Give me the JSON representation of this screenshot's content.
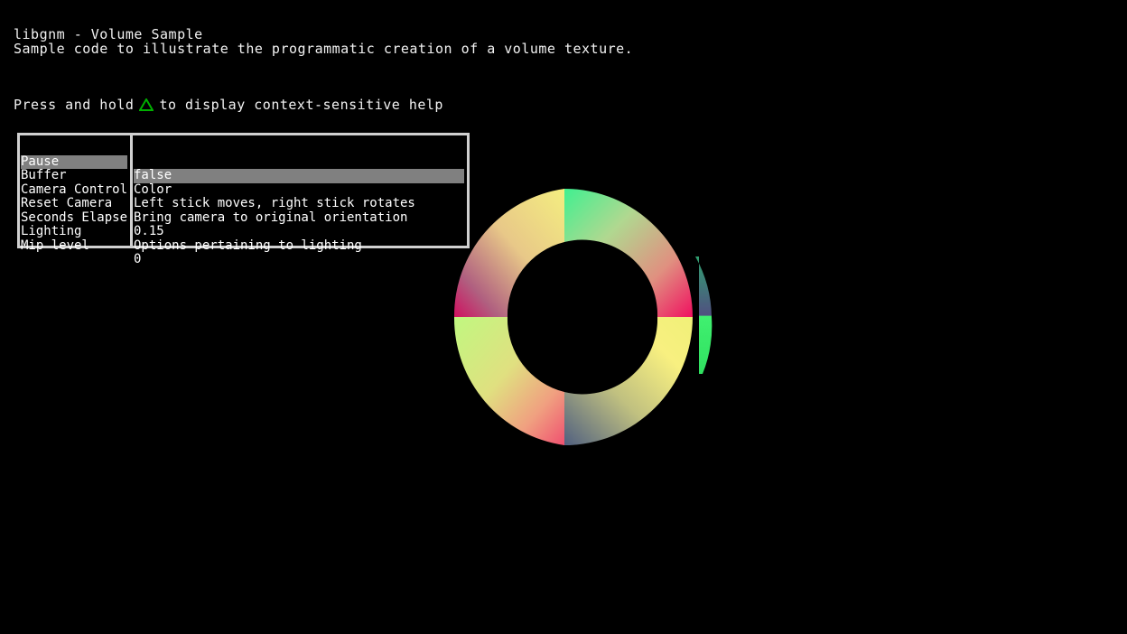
{
  "header": {
    "title": "libgnm - Volume Sample",
    "subtitle": "Sample code to illustrate the programmatic creation of a volume texture.",
    "help_prefix": "Press and hold",
    "help_suffix": "to display context-sensitive help",
    "help_icon": "triangle-button-icon",
    "help_icon_color": "#00b000"
  },
  "menu": {
    "items": [
      {
        "label": "Pause",
        "value": "false",
        "selected": true
      },
      {
        "label": "Buffer",
        "value": "Color",
        "selected": false
      },
      {
        "label": "Camera Controls",
        "value": "Left stick moves, right stick rotates",
        "selected": false
      },
      {
        "label": "Reset Camera",
        "value": "Bring camera to original orientation",
        "selected": false
      },
      {
        "label": "Seconds Elapsed",
        "value": "0.15",
        "selected": false
      },
      {
        "label": "Lighting",
        "value": "Options pertaining to lighting",
        "selected": false
      },
      {
        "label": "Mip level",
        "value": "0",
        "selected": false
      }
    ],
    "highlight_color": "#808080",
    "border_color": "#d0d0d0"
  },
  "scene": {
    "object": "volume-textured-torus"
  }
}
